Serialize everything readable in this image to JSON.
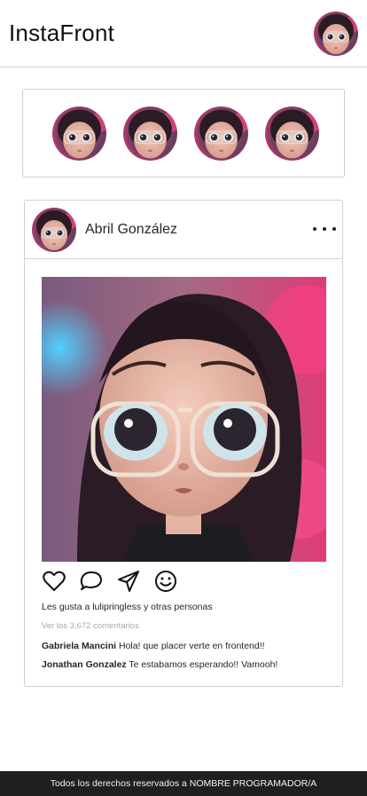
{
  "header": {
    "brand": "InstaFront",
    "avatar_icon": "girl-avatar"
  },
  "stories": {
    "count": 4,
    "avatar_icon": "girl-avatar"
  },
  "post": {
    "user_name": "Abril González",
    "more_icon": "more-dots-icon",
    "photo_icon": "girl-portrait",
    "actions": [
      "heart-icon",
      "comment-icon",
      "send-icon",
      "smile-icon"
    ],
    "likes_text": "Les gusta a lulipringless y otras personas",
    "view_comments": "Ver los 3,672 comentarios",
    "comments": [
      {
        "user": "Gabriela Mancini",
        "text": "Hola! que placer verte en frontend!!"
      },
      {
        "user": "Jonathan Gonzalez",
        "text": "Te estabamos esperando!! Vamooh!"
      }
    ]
  },
  "footer": {
    "text": "Todos los derechos reservados a NOMBRE PROGRAMADOR/A"
  },
  "colors": {
    "accent_pink": "#d93a6a",
    "border": "#cfcfcf",
    "footer_bg": "#1f1f1f"
  }
}
